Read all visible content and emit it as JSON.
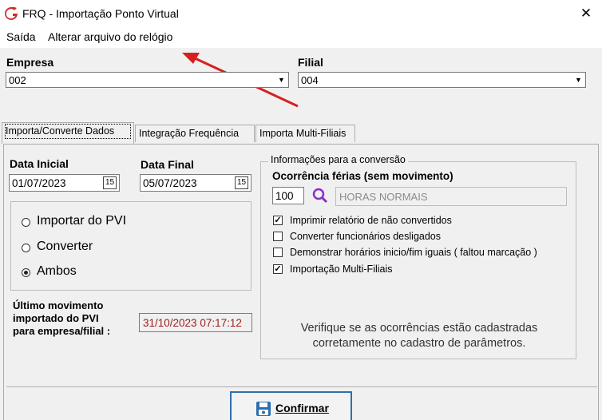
{
  "window": {
    "title": "FRQ - Importação Ponto Virtual",
    "close_glyph": "✕",
    "logo_icon": "frq-logo-icon"
  },
  "menu": {
    "items": [
      "Saída",
      "Alterar arquivo do relógio"
    ]
  },
  "empresa": {
    "label": "Empresa",
    "value": "002"
  },
  "filial": {
    "label": "Filial",
    "value": "004"
  },
  "tabs": [
    {
      "label": "Importa/Converte Dados",
      "active": true
    },
    {
      "label": "Integração Frequência",
      "active": false
    },
    {
      "label": "Importa Multi-Filiais",
      "active": false
    }
  ],
  "dates": {
    "initial_label": "Data Inicial",
    "initial_value": "01/07/2023",
    "final_label": "Data Final",
    "final_value": "05/07/2023",
    "calendar_glyph": "15"
  },
  "mode": {
    "options": [
      "Importar do PVI",
      "Converter",
      "Ambos"
    ],
    "selected": "Ambos"
  },
  "last_movement": {
    "label_line1": "Último movimento",
    "label_line2": "importado do PVI",
    "label_line3": "para empresa/filial :",
    "value": "31/10/2023  07:17:12"
  },
  "conversion": {
    "group_title": "Informações para a conversão",
    "ferias_label": "Ocorrência férias (sem movimento)",
    "ferias_code": "100",
    "ferias_desc": "HORAS NORMAIS",
    "checkboxes": [
      {
        "label": "Imprimir relatório de não convertidos",
        "checked": true
      },
      {
        "label": "Converter funcionários desligados",
        "checked": false
      },
      {
        "label": "Demonstrar horários inicio/fim iguais ( faltou marcação )",
        "checked": false
      },
      {
        "label": "Importação Multi-Filiais",
        "checked": true
      }
    ],
    "note_line1": "Verifique se as ocorrências estão cadastradas",
    "note_line2": "corretamente  no cadastro de parâmetros."
  },
  "confirm": {
    "label": "Confirmar"
  },
  "colors": {
    "annotation_arrow": "#d62020",
    "accent_blue": "#2c6fb0",
    "readonly_red": "#9c1c1c",
    "search_purple": "#8b2fc9"
  }
}
